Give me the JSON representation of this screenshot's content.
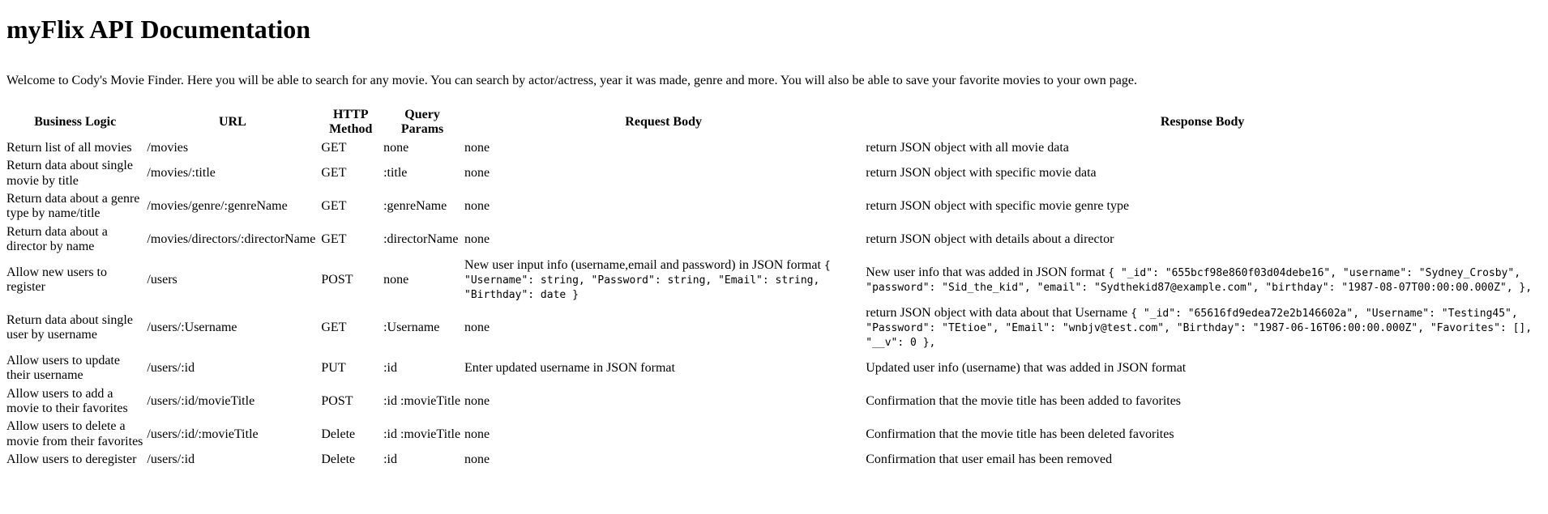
{
  "header": {
    "title": "myFlix API Documentation"
  },
  "intro": "Welcome to Cody's Movie Finder. Here you will be able to search for any movie. You can search by actor/actress, year it was made, genre and more. You will also be able to save your favorite movies to your own page.",
  "table": {
    "columns": [
      "Business Logic",
      "URL",
      "HTTP Method",
      "Query Params",
      "Request Body",
      "Response Body"
    ],
    "rows": [
      {
        "logic": "Return list of all movies",
        "url": "/movies",
        "method": "GET",
        "query": "none",
        "request_text": "none",
        "request_code": "",
        "response_text": "return JSON object with all movie data",
        "response_code": ""
      },
      {
        "logic": "Return data about single movie by title",
        "url": "/movies/:title",
        "method": "GET",
        "query": ":title",
        "request_text": "none",
        "request_code": "",
        "response_text": "return JSON object with specific movie data",
        "response_code": ""
      },
      {
        "logic": "Return data about a genre type by name/title",
        "url": "/movies/genre/:genreName",
        "method": "GET",
        "query": ":genreName",
        "request_text": "none",
        "request_code": "",
        "response_text": "return JSON object with specific movie genre type",
        "response_code": ""
      },
      {
        "logic": "Return data about a director by name",
        "url": "/movies/directors/:directorName",
        "method": "GET",
        "query": ":directorName",
        "request_text": "none",
        "request_code": "",
        "response_text": "return JSON object with details about a director",
        "response_code": ""
      },
      {
        "logic": "Allow new users to register",
        "url": "/users",
        "method": "POST",
        "query": "none",
        "request_text": "New user input info (username,email and password) in JSON format ",
        "request_code": "{ \"Username\": string, \"Password\": string, \"Email\": string, \"Birthday\": date }",
        "response_text": "New user info that was added in JSON format ",
        "response_code": "{ \"_id\": \"655bcf98e860f03d04debe16\", \"username\": \"Sydney_Crosby\", \"password\": \"Sid_the_kid\", \"email\": \"Sydthekid87@example.com\", \"birthday\": \"1987-08-07T00:00:00.000Z\", },"
      },
      {
        "logic": "Return data about single user by username",
        "url": "/users/:Username",
        "method": "GET",
        "query": ":Username",
        "request_text": "none",
        "request_code": "",
        "response_text": "return JSON object with data about that Username ",
        "response_code": "{ \"_id\": \"65616fd9edea72e2b146602a\", \"Username\": \"Testing45\", \"Password\": \"TEtioe\", \"Email\": \"wnbjv@test.com\", \"Birthday\": \"1987-06-16T06:00:00.000Z\", \"Favorites\": [], \"__v\": 0 },"
      },
      {
        "logic": "Allow users to update their username",
        "url": "/users/:id",
        "method": "PUT",
        "query": ":id",
        "request_text": "Enter updated username in JSON format",
        "request_code": "",
        "response_text": "Updated user info (username) that was added in JSON format",
        "response_code": ""
      },
      {
        "logic": "Allow users to add a movie to their favorites",
        "url": "/users/:id/movieTitle",
        "method": "POST",
        "query": ":id :movieTitle",
        "request_text": "none",
        "request_code": "",
        "response_text": "Confirmation that the movie title has been added to favorites",
        "response_code": ""
      },
      {
        "logic": "Allow users to delete a movie from their favorites",
        "url": "/users/:id/:movieTitle",
        "method": "Delete",
        "query": ":id :movieTitle",
        "request_text": "none",
        "request_code": "",
        "response_text": "Confirmation that the movie title has been deleted favorites",
        "response_code": ""
      },
      {
        "logic": "Allow users to deregister",
        "url": "/users/:id",
        "method": "Delete",
        "query": ":id",
        "request_text": "none",
        "request_code": "",
        "response_text": "Confirmation that user email has been removed",
        "response_code": ""
      }
    ]
  }
}
